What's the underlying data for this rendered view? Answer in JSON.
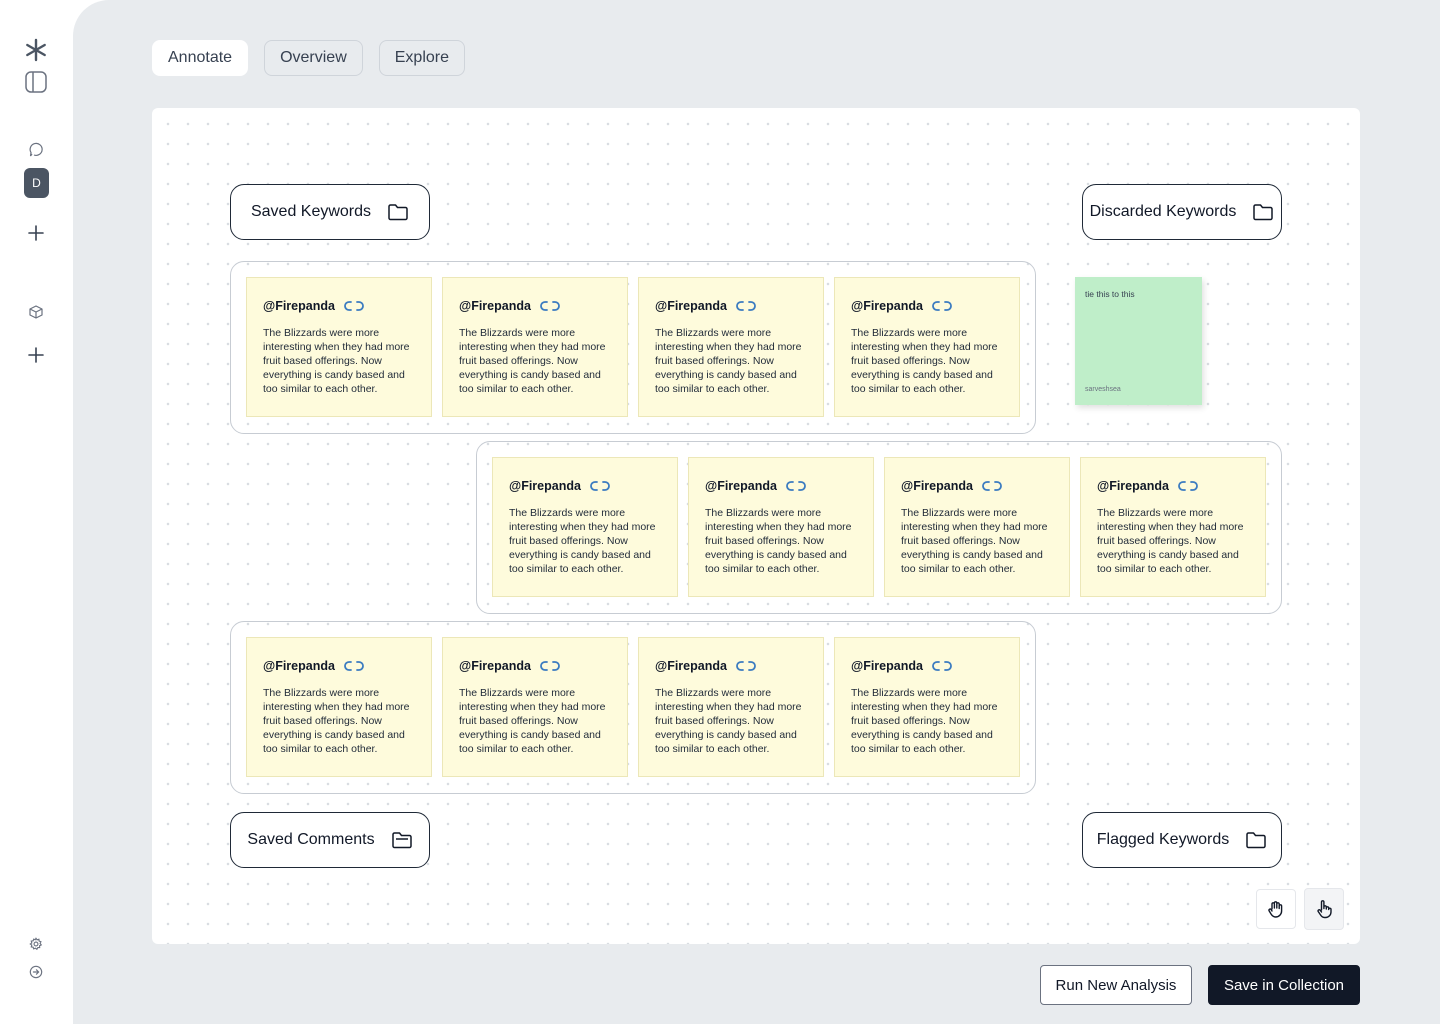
{
  "tabs": [
    {
      "label": "Annotate",
      "active": true
    },
    {
      "label": "Overview",
      "active": false
    },
    {
      "label": "Explore",
      "active": false
    }
  ],
  "sidebar": {
    "avatar_letter": "D",
    "icons": [
      "asterisk-logo-icon",
      "panel-toggle-icon",
      "chat-icon",
      "plus-icon",
      "cube-icon",
      "plus-icon",
      "settings-icon",
      "logout-icon"
    ]
  },
  "folders": {
    "saved_keywords": "Saved Keywords",
    "discarded_keywords": "Discarded Keywords",
    "saved_comments": "Saved Comments",
    "flagged_keywords": "Flagged Keywords"
  },
  "card": {
    "user": "@Firepanda",
    "text": "The Blizzards were more interesting when they had more fruit based offerings. Now everything is candy based and too similar to each other."
  },
  "sticky": {
    "text": "tie this to this",
    "author": "sarveshsea"
  },
  "actions": {
    "run_analysis": "Run New Analysis",
    "save_collection": "Save in Collection"
  },
  "colors": {
    "card_bg": "#fefbdc",
    "sticky_bg": "#bfeec9",
    "link_icon": "#3b7bc0",
    "primary_button": "#111827"
  }
}
